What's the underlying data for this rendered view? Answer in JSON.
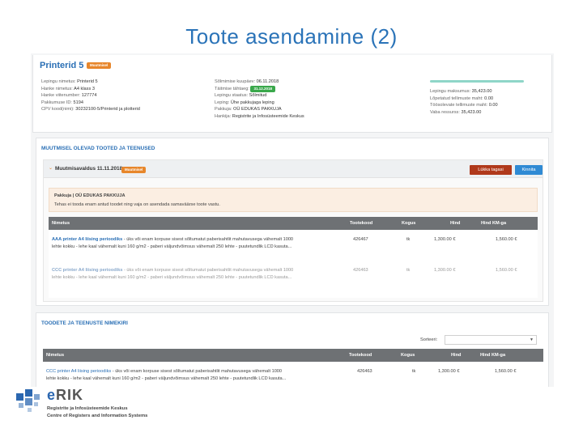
{
  "slide": {
    "title": "Toote asendamine (2)"
  },
  "header": {
    "title": "Printerid 5",
    "badge": "Muutmisel",
    "col1": [
      {
        "k": "Lepingu nimetus:",
        "v": "Printerid 5"
      },
      {
        "k": "Hanke nimetus:",
        "v": "A4 klass 3"
      },
      {
        "k": "Hanke viitenumber:",
        "v": "127774"
      },
      {
        "k": "Pakkumuse ID:",
        "v": "5194"
      },
      {
        "k": "CPV kood(nimi):",
        "v": "30232100-5/Printerid ja plotterid"
      }
    ],
    "col2": [
      {
        "k": "Sõlmimise kuupäev:",
        "v": "06.11.2018",
        "badge": ""
      },
      {
        "k": "Täitmise tähtaeg:",
        "v": "",
        "badge": "31.12.2018"
      },
      {
        "k": "Lepingu staatus:",
        "v": "Sõlmitud",
        "badge": ""
      },
      {
        "k": "Leping:",
        "v": "Ühe pakkujaga leping",
        "badge": ""
      },
      {
        "k": "Pakkuja:",
        "v": "OÜ EDUKAS PAKKUJA",
        "badge": ""
      },
      {
        "k": "Hankija:",
        "v": "Registrite ja Infosüsteemide Keskus",
        "badge": ""
      }
    ],
    "col3": [
      {
        "k": "Lepingu maksumus:",
        "v": "35,423.00"
      },
      {
        "k": "Lõpetatud tellimuste maht:",
        "v": "0.00"
      },
      {
        "k": "Töösolevate tellimuste maht:",
        "v": "0.00"
      },
      {
        "k": "Vaba ressurss:",
        "v": "35,423.00"
      }
    ]
  },
  "changes": {
    "section_title": "MUUTMISEL OLEVAD TOOTED JA TEENUSED",
    "change_title": "Muutmisavaldus 11.11.2018",
    "change_badge": "Muutmisel",
    "reject_label": "Lükka tagasi",
    "confirm_label": "Kinnita",
    "notice_title": "Pakkuja | OÜ EDUKAS PAKKUJA",
    "notice_text": "Tehas ei tooda enam antud toodet ning vaja on asendada samaväärse toote vastu.",
    "columns": [
      "Nimetus",
      "Tootekood",
      "Kogus",
      "Hind",
      "Hind KM-ga"
    ],
    "rows": [
      {
        "name": "AAA printer A4 liising perioodiks",
        "desc": " - üks või enam korpuse sisest sõltumatut paberisahtlit mahutavusega vähemalt 1000 lehte kokku - lehe kaal vähemalt kuni 160 g/m2 - paberi väljundvõimsus vähemalt 250 lehte - puutetundlik LCD kasuta...",
        "code": "426467",
        "qty": "tk",
        "price": "1,300.00 €",
        "price_vat": "1,560.00 €",
        "struck": false
      },
      {
        "name": "CCC printer A4 liising perioodiks",
        "desc": " - üks või enam korpuse sisest sõltumatut paberisahtlit mahutavusega vähemalt 1000 lehte kokku - lehe kaal vähemalt kuni 160 g/m2 - paberi väljundvõimsus vähemalt 250 lehte - puutetundlik LCD kasuta...",
        "code": "426463",
        "qty": "tk",
        "price": "1,300.00 €",
        "price_vat": "1,560.00 €",
        "struck": true
      }
    ]
  },
  "list": {
    "section_title": "TOODETE JA TEENUSTE NIMEKIRI",
    "sort_label": "Sorteeri:",
    "sort_value": "",
    "columns": [
      "Nimetus",
      "Tootekood",
      "Kogus",
      "Hind",
      "Hind KM-ga"
    ],
    "rows": [
      {
        "name": "CCC printer A4 liising perioodiks",
        "desc": " - üks või enam korpuse sisest sõltumatut paberisahtlit mahutavusega vähemalt 1000 lehte kokku - lehe kaal vähemalt kuni 160 g/m2 - paberi väljundvõimsus vähemalt 250 lehte - puutetundlik LCD kasuta...",
        "code": "426463",
        "qty": "tk",
        "price": "1,300.00 €",
        "price_vat": "1,560.00 €"
      }
    ]
  },
  "logo": {
    "brand_e": "e",
    "brand_rest": "RIK",
    "line1": "Registrite ja Infosüsteemide Keskus",
    "line2": "Centre of Registers and Information Systems"
  },
  "colors": {
    "accent": "#2a6fb5",
    "badge_orange": "#e7862b",
    "badge_green": "#3aa84b",
    "reject": "#b0391b",
    "confirm": "#2f8ad4"
  }
}
